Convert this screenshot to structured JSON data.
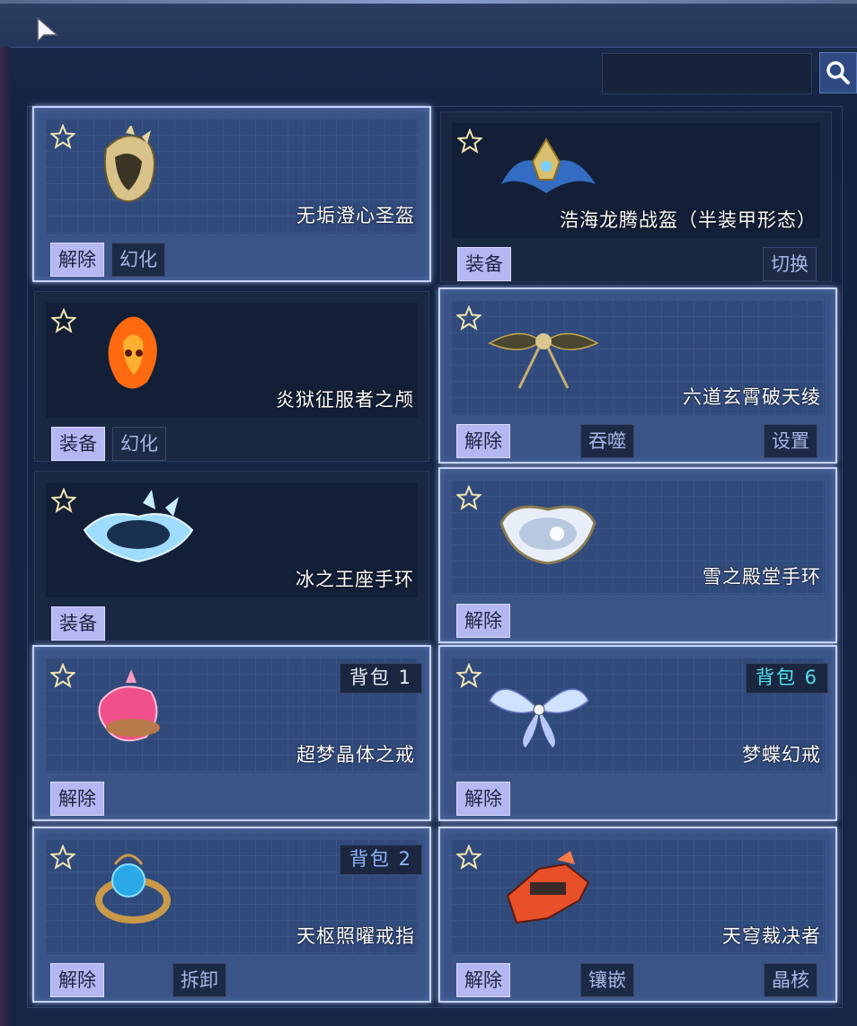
{
  "colors": {
    "active_border": "#c5d4ff",
    "primary_button": "#b4b7f2",
    "dark_button_text": "#aab4e8",
    "badge_cyan": "#4de0f0",
    "badge_blue": "#8fb7ff"
  },
  "search": {
    "placeholder": ""
  },
  "items": [
    {
      "name": "无垢澄心圣盔",
      "icon": "golden-helmet-icon",
      "buttons": [
        "解除",
        "幻化"
      ],
      "badge": ""
    },
    {
      "name": "浩海龙腾战盔（半装甲形态）",
      "icon": "dragon-crown-icon",
      "buttons": [
        "装备",
        "切换"
      ],
      "badge": ""
    },
    {
      "name": "炎狱征服者之颅",
      "icon": "flame-skull-icon",
      "buttons": [
        "装备",
        "幻化"
      ],
      "badge": ""
    },
    {
      "name": "六道玄霄破天绫",
      "icon": "winged-sash-icon",
      "buttons": [
        "解除",
        "吞噬",
        "设置"
      ],
      "badge": ""
    },
    {
      "name": "冰之王座手环",
      "icon": "ice-bracelet-icon",
      "buttons": [
        "装备"
      ],
      "badge": ""
    },
    {
      "name": "雪之殿堂手环",
      "icon": "silver-bracelet-icon",
      "buttons": [
        "解除"
      ],
      "badge": ""
    },
    {
      "name": "超梦晶体之戒",
      "icon": "pink-crystal-ring-icon",
      "buttons": [
        "解除"
      ],
      "badge": "背包 1"
    },
    {
      "name": "梦蝶幻戒",
      "icon": "butterfly-ring-icon",
      "buttons": [
        "解除"
      ],
      "badge": "背包 6"
    },
    {
      "name": "天枢照曜戒指",
      "icon": "orb-ring-icon",
      "buttons": [
        "解除",
        "拆卸"
      ],
      "badge": "背包 2"
    },
    {
      "name": "天穹裁决者",
      "icon": "red-mech-icon",
      "buttons": [
        "解除",
        "镶嵌",
        "晶核"
      ],
      "badge": ""
    }
  ]
}
